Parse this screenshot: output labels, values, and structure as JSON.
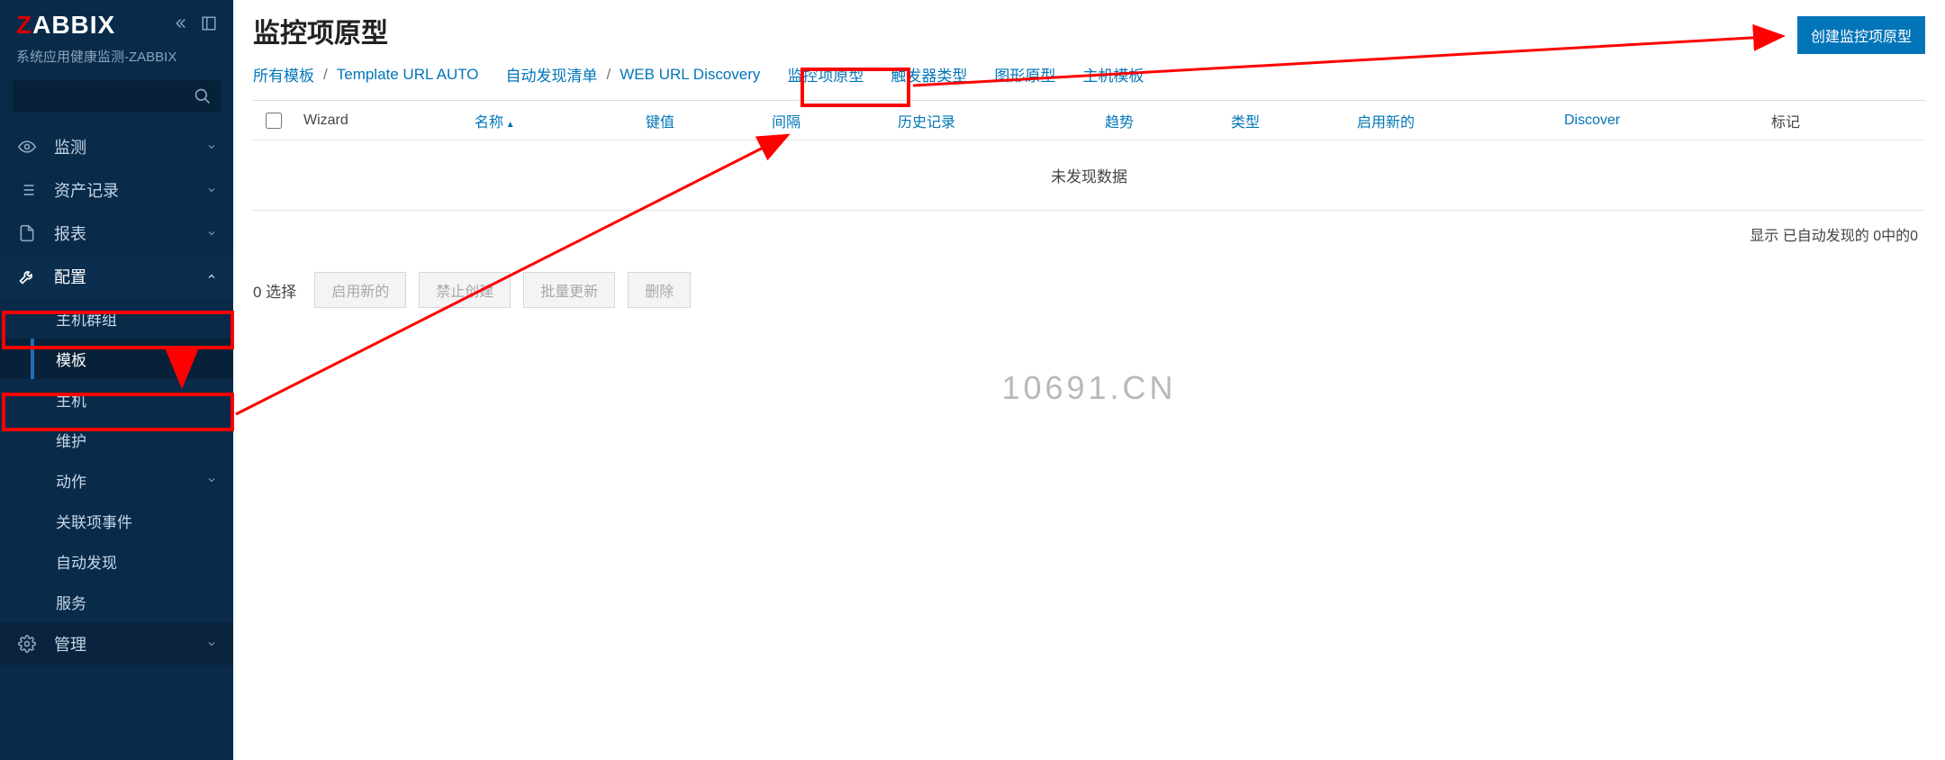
{
  "brand": {
    "z": "Z",
    "rest": "ABBIX"
  },
  "subtitle": "系统应用健康监测-ZABBIX",
  "nav": {
    "monitoring": "监测",
    "inventory": "资产记录",
    "reports": "报表",
    "configuration": "配置",
    "administration": "管理"
  },
  "config_sub": {
    "hostgroups": "主机群组",
    "templates": "模板",
    "hosts": "主机",
    "maintenance": "维护",
    "actions": "动作",
    "correlation": "关联项事件",
    "discovery": "自动发现",
    "services": "服务"
  },
  "page": {
    "title": "监控项原型",
    "create_btn": "创建监控项原型"
  },
  "breadcrumb": {
    "all_templates": "所有模板",
    "template": "Template URL AUTO",
    "auto_discovery": "自动发现清单",
    "web_discovery": "WEB URL Discovery",
    "item_proto": "监控项原型",
    "trigger_proto": "触发器类型",
    "graph_proto": "图形原型",
    "host_proto": "主机模板"
  },
  "columns": {
    "wizard": "Wizard",
    "name": "名称",
    "key": "键值",
    "interval": "间隔",
    "history": "历史记录",
    "trends": "趋势",
    "type": "类型",
    "enable": "启用新的",
    "discover": "Discover",
    "tags": "标记"
  },
  "table": {
    "no_data": "未发现数据",
    "summary": "显示 已自动发现的 0中的0"
  },
  "actions": {
    "selected": "0 选择",
    "enable": "启用新的",
    "disable": "禁止创建",
    "mass_update": "批量更新",
    "delete": "删除"
  },
  "watermark": "10691.CN"
}
